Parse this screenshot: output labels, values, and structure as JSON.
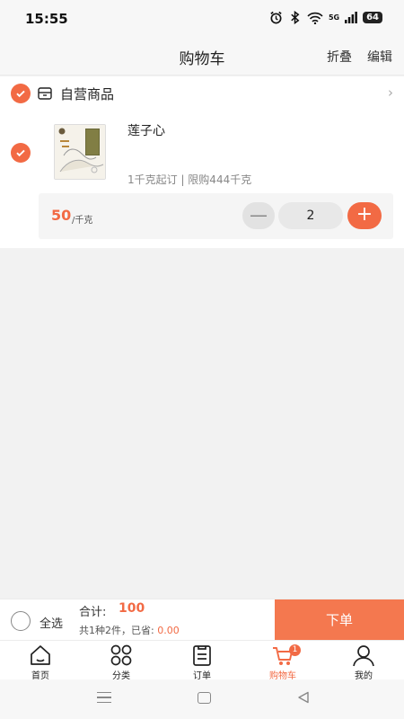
{
  "status_bar": {
    "time": "15:55",
    "network": "5G",
    "battery": "64"
  },
  "header": {
    "title": "购物车",
    "fold_label": "折叠",
    "edit_label": "编辑"
  },
  "store": {
    "name": "自营商品"
  },
  "item": {
    "name": "莲子心",
    "limit_text": "1千克起订 | 限购444千克",
    "price": "50",
    "price_unit": "/千克",
    "minus_symbol": "—",
    "quantity": "2",
    "plus_symbol": "+"
  },
  "checkout": {
    "select_all_label": "全选",
    "total_label": "合计:",
    "total_value": "100",
    "summary_text": "共1种2件，已省:",
    "saved_value": "0.00",
    "order_button": "下单"
  },
  "tabs": [
    {
      "label": "首页",
      "icon": "home-icon"
    },
    {
      "label": "分类",
      "icon": "category-icon"
    },
    {
      "label": "订单",
      "icon": "order-icon"
    },
    {
      "label": "购物车",
      "icon": "cart-icon",
      "badge": "1",
      "active": true
    },
    {
      "label": "我的",
      "icon": "profile-icon"
    }
  ],
  "colors": {
    "accent": "#f26a44",
    "order_button": "#f4784f",
    "background": "#f2f2f2"
  }
}
